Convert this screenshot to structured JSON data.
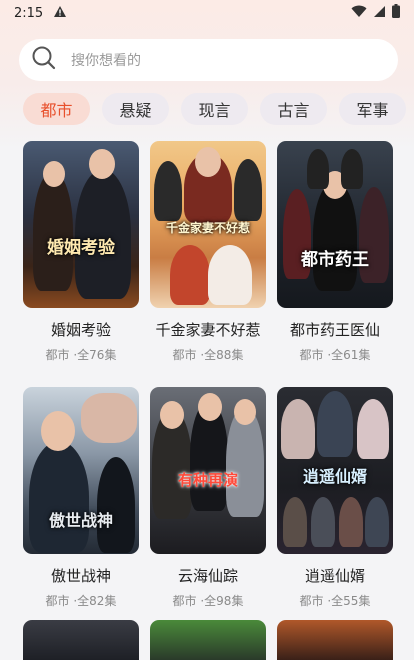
{
  "status_bar": {
    "time": "2:15"
  },
  "search": {
    "placeholder": "搜你想看的"
  },
  "tabs": [
    {
      "label": "都市",
      "active": true
    },
    {
      "label": "悬疑",
      "active": false
    },
    {
      "label": "现言",
      "active": false
    },
    {
      "label": "古言",
      "active": false
    },
    {
      "label": "军事",
      "active": false
    }
  ],
  "cards": [
    {
      "title": "婚姻考验",
      "meta": "都市 ·全76集",
      "poster_text": "婚姻考验"
    },
    {
      "title": "千金家妻不好惹",
      "meta": "都市 ·全88集",
      "poster_text": "千金家妻不好惹"
    },
    {
      "title": "都市药王医仙",
      "meta": "都市 ·全61集",
      "poster_text": "都市药王"
    },
    {
      "title": "傲世战神",
      "meta": "都市 ·全82集",
      "poster_text": "傲世战神"
    },
    {
      "title": "云海仙踪",
      "meta": "都市 ·全98集",
      "poster_text": "有种再演"
    },
    {
      "title": "逍遥仙婿",
      "meta": "都市 ·全55集",
      "poster_text": "逍遥仙婿"
    }
  ],
  "colors": {
    "accent": "#e8502c",
    "tab_active_bg": "#f9dcd4"
  }
}
